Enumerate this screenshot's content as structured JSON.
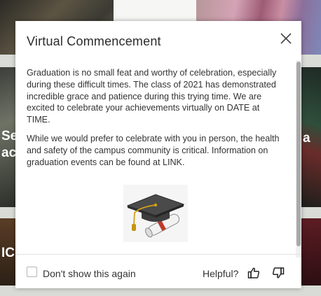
{
  "background": {
    "left_text_1": "Se",
    "left_text_2": "ac",
    "right_text": "a",
    "left_text_3": "IC"
  },
  "popup": {
    "title": "Virtual Commencement",
    "paragraphs": [
      "Graduation is no small feat and worthy of celebration, especially during these difficult times. The class of 2021 has demonstrated incredible grace and patience during this trying time. We are excited to celebrate your achievements virtually on DATE at TIME.",
      "While we would prefer to celebrate with you in person, the health and safety of the campus community is critical. Information on graduation events can be found at LINK."
    ],
    "illustration": "graduation-cap-and-diploma",
    "close_icon": "close-icon"
  },
  "footer": {
    "dont_show_label": "Don't show this again",
    "dont_show_checked": false,
    "helpful_label": "Helpful?",
    "thumbs_up_icon": "thumbs-up-icon",
    "thumbs_down_icon": "thumbs-down-icon"
  },
  "colors": {
    "popup_bg": "#ffffff",
    "text": "#333333",
    "scrollbar_thumb": "#a9a9a9"
  }
}
